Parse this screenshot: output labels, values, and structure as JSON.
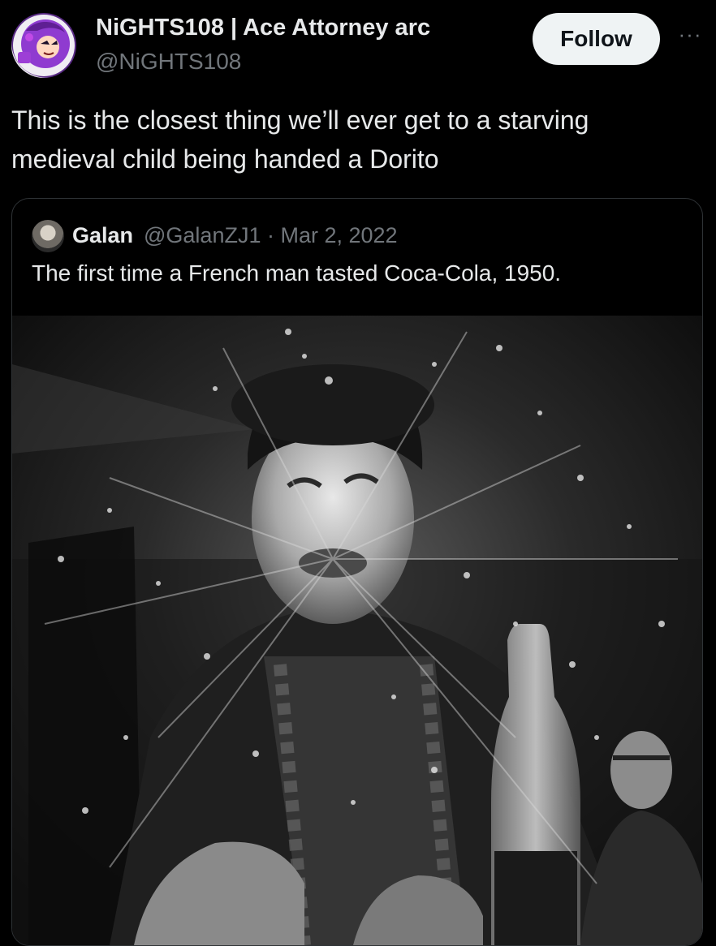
{
  "author": {
    "display_name": "NiGHTS108 | Ace Attorney arc",
    "handle": "@NiGHTS108"
  },
  "actions": {
    "follow_label": "Follow",
    "more_label": "···"
  },
  "tweet": {
    "text": "This is the closest thing we’ll ever get to a starving medieval child being handed a Dorito"
  },
  "quoted_tweet": {
    "author_name": "Galan",
    "author_meta": "@GalanZJ1 · Mar 2, 2022",
    "text": "The first time a French man tasted Coca-Cola, 1950."
  },
  "icons": {
    "avatar": "user-avatar",
    "quoted_avatar": "quoted-user-avatar",
    "more": "more-options-icon"
  }
}
